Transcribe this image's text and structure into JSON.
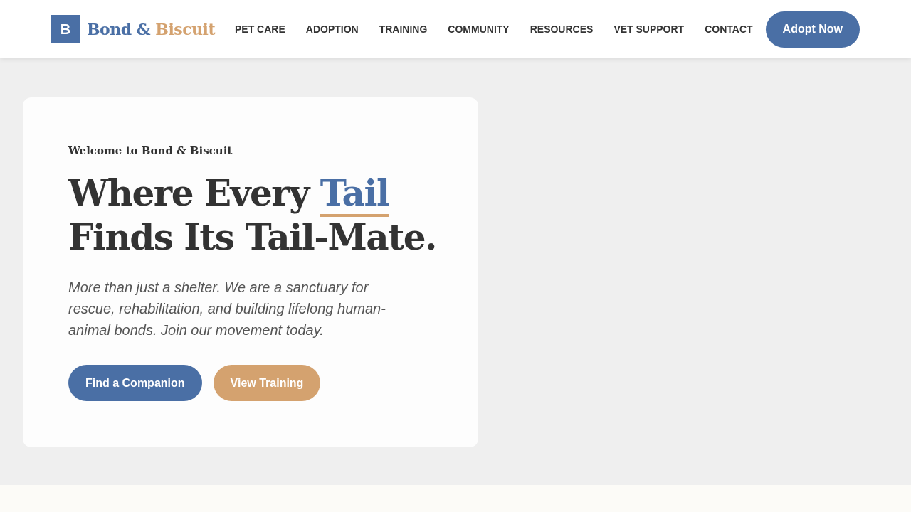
{
  "header": {
    "logo": {
      "mark": "B",
      "name": "Bond &",
      "accent": "Biscuit"
    },
    "nav": [
      "PET CARE",
      "ADOPTION",
      "TRAINING",
      "COMMUNITY",
      "RESOURCES",
      "VET SUPPORT",
      "CONTACT"
    ],
    "cta": "Adopt Now"
  },
  "hero": {
    "eyebrow": "Welcome to Bond & Biscuit",
    "headline_before": "Where Every",
    "headline_highlight": "Tail",
    "headline_after": "Finds Its Tail-Mate.",
    "lead": "More than just a shelter. We are a sanctuary for rescue, rehabilitation, and building lifelong human-animal bonds. Join our movement today.",
    "buttons": [
      {
        "label": "Find a Companion",
        "kind": "primary"
      },
      {
        "label": "View Training",
        "kind": "secondary"
      }
    ]
  }
}
